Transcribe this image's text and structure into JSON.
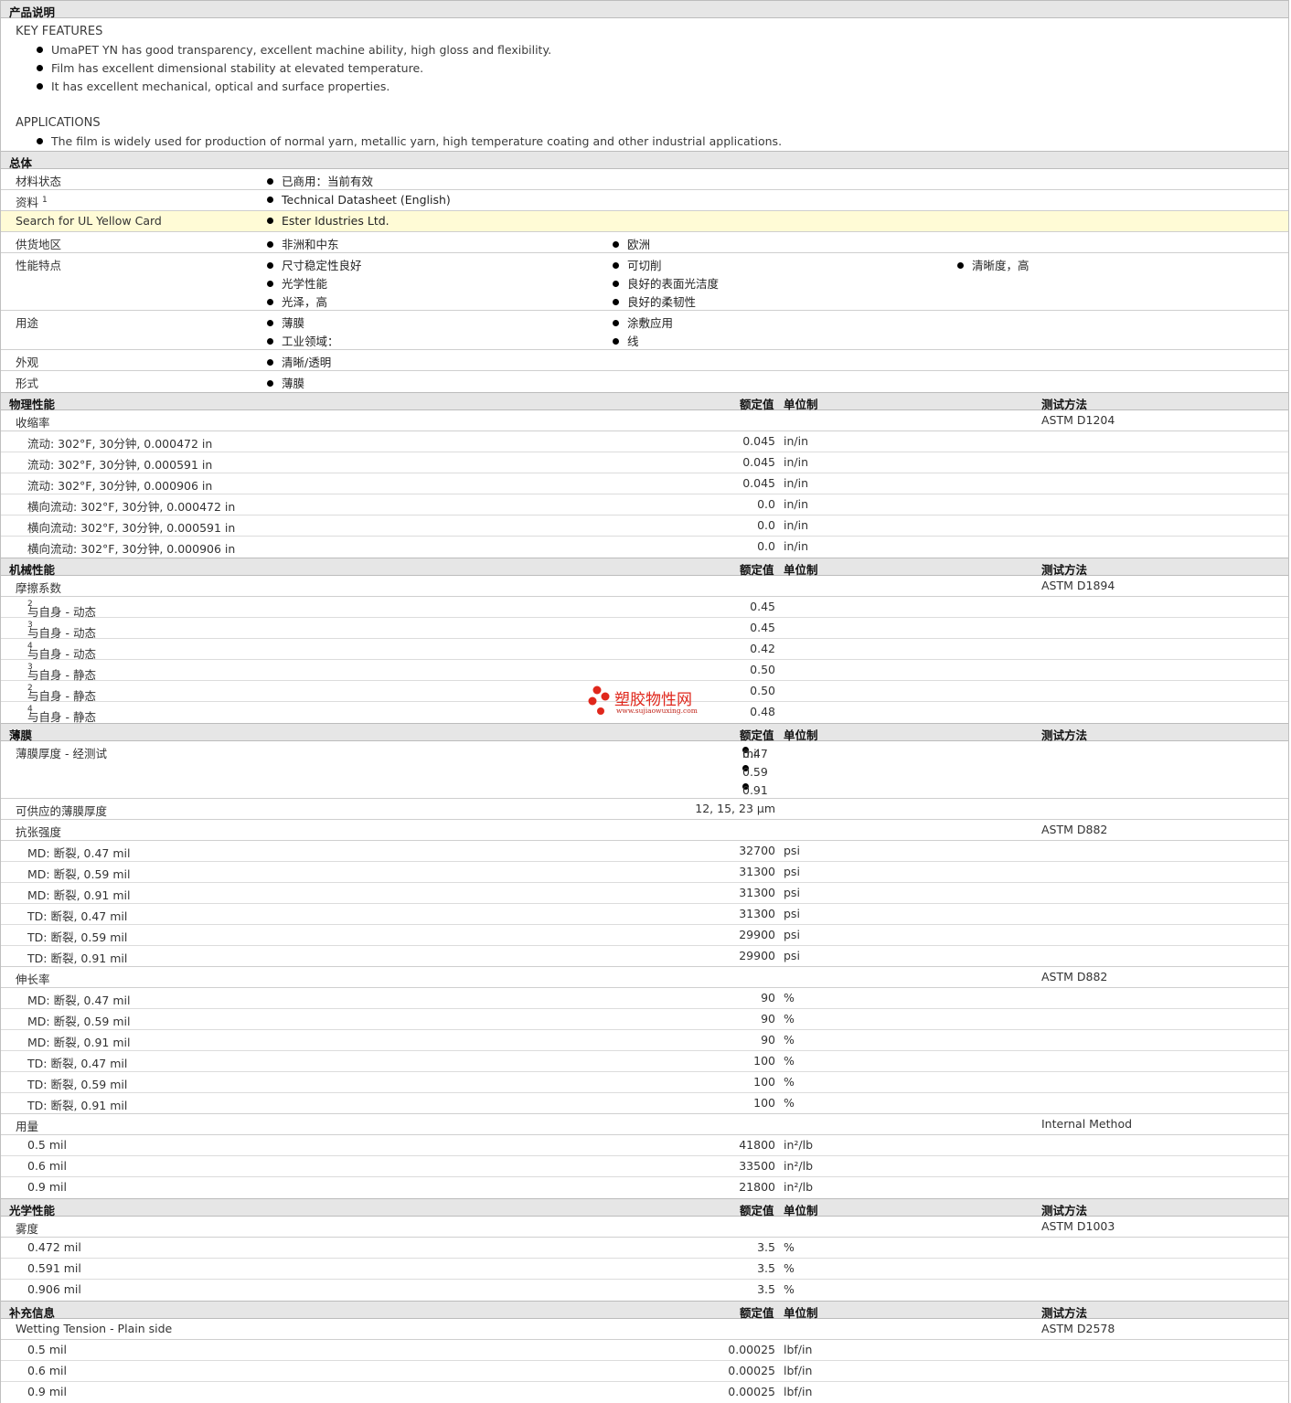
{
  "description": {
    "section_title": "产品说明",
    "key_features_heading": "KEY FEATURES",
    "key_features": [
      "UmaPET YN has good transparency, excellent machine ability, high gloss and flexibility.",
      "Film has excellent dimensional stability at elevated temperature.",
      "It has excellent mechanical, optical and surface properties."
    ],
    "applications_heading": "APPLICATIONS",
    "applications": [
      "The film is widely used for production of normal yarn, metallic yarn, high temperature coating and other industrial applications."
    ]
  },
  "general": {
    "section_title": "总体",
    "rows": [
      {
        "label": "材料状态",
        "items": [
          "已商用：当前有效"
        ]
      },
      {
        "label": "资料",
        "sup": "1",
        "items": [
          "Technical Datasheet (English)"
        ]
      },
      {
        "label": "Search for UL Yellow Card",
        "items": [
          "Ester Idustries Ltd."
        ]
      },
      {
        "label": "供货地区",
        "items": [
          "非洲和中东",
          "欧洲"
        ]
      },
      {
        "label": "性能特点",
        "items": [
          "尺寸稳定性良好",
          "可切削",
          "清晰度，高",
          "光学性能",
          "良好的表面光洁度",
          "光泽，高",
          "良好的柔韧性"
        ]
      },
      {
        "label": "用途",
        "items": [
          "薄膜",
          "涂敷应用",
          "工业领域：",
          "线"
        ]
      },
      {
        "label": "外观",
        "items": [
          "清晰/透明"
        ]
      },
      {
        "label": "形式",
        "items": [
          "薄膜"
        ]
      }
    ]
  },
  "headers": {
    "nominal": "额定值",
    "unit": "单位制",
    "method": "测试方法"
  },
  "physical": {
    "section_title": "物理性能",
    "group": "收缩率",
    "method": "ASTM D1204",
    "rows": [
      {
        "label": "流动: 302°F, 30分钟, 0.000472 in",
        "value": "0.045",
        "unit": "in/in"
      },
      {
        "label": "流动: 302°F, 30分钟, 0.000591 in",
        "value": "0.045",
        "unit": "in/in"
      },
      {
        "label": "流动: 302°F, 30分钟, 0.000906 in",
        "value": "0.045",
        "unit": "in/in"
      },
      {
        "label": "横向流动: 302°F, 30分钟, 0.000472 in",
        "value": "0.0",
        "unit": "in/in"
      },
      {
        "label": "横向流动: 302°F, 30分钟, 0.000591 in",
        "value": "0.0",
        "unit": "in/in"
      },
      {
        "label": "横向流动: 302°F, 30分钟, 0.000906 in",
        "value": "0.0",
        "unit": "in/in"
      }
    ]
  },
  "mechanical": {
    "section_title": "机械性能",
    "group": "摩擦系数",
    "method": "ASTM D1894",
    "rows": [
      {
        "label": "与自身  - 动态",
        "sup": "2",
        "value": "0.45"
      },
      {
        "label": "与自身  - 动态",
        "sup": "3",
        "value": "0.45"
      },
      {
        "label": "与自身  - 动态",
        "sup": "4",
        "value": "0.42"
      },
      {
        "label": "与自身  - 静态",
        "sup": "3",
        "value": "0.50"
      },
      {
        "label": "与自身  - 静态",
        "sup": "2",
        "value": "0.50"
      },
      {
        "label": "与自身  - 静态",
        "sup": "4",
        "value": "0.48"
      }
    ]
  },
  "film": {
    "section_title": "薄膜",
    "thickness": {
      "label": "薄膜厚度  - 经测试",
      "values": [
        "0.47",
        "0.59",
        "0.91"
      ],
      "unit": "mil"
    },
    "available": {
      "label": "可供应的薄膜厚度",
      "value": "12, 15, 23 µm"
    },
    "tensile": {
      "group": "抗张强度",
      "method": "ASTM D882",
      "rows": [
        {
          "label": "MD: 断裂, 0.47 mil",
          "value": "32700",
          "unit": "psi"
        },
        {
          "label": "MD: 断裂, 0.59 mil",
          "value": "31300",
          "unit": "psi"
        },
        {
          "label": "MD: 断裂, 0.91 mil",
          "value": "31300",
          "unit": "psi"
        },
        {
          "label": "TD: 断裂, 0.47 mil",
          "value": "31300",
          "unit": "psi"
        },
        {
          "label": "TD: 断裂, 0.59 mil",
          "value": "29900",
          "unit": "psi"
        },
        {
          "label": "TD: 断裂, 0.91 mil",
          "value": "29900",
          "unit": "psi"
        }
      ]
    },
    "elongation": {
      "group": "伸长率",
      "method": "ASTM D882",
      "rows": [
        {
          "label": "MD: 断裂, 0.47 mil",
          "value": "90",
          "unit": "%"
        },
        {
          "label": "MD: 断裂, 0.59 mil",
          "value": "90",
          "unit": "%"
        },
        {
          "label": "MD: 断裂, 0.91 mil",
          "value": "90",
          "unit": "%"
        },
        {
          "label": "TD: 断裂, 0.47 mil",
          "value": "100",
          "unit": "%"
        },
        {
          "label": "TD: 断裂, 0.59 mil",
          "value": "100",
          "unit": "%"
        },
        {
          "label": "TD: 断裂, 0.91 mil",
          "value": "100",
          "unit": "%"
        }
      ]
    },
    "yield": {
      "group": "用量",
      "method": "Internal Method",
      "rows": [
        {
          "label": "0.5 mil",
          "value": "41800",
          "unit": "in²/lb"
        },
        {
          "label": "0.6 mil",
          "value": "33500",
          "unit": "in²/lb"
        },
        {
          "label": "0.9 mil",
          "value": "21800",
          "unit": "in²/lb"
        }
      ]
    }
  },
  "optical": {
    "section_title": "光学性能",
    "group": "雾度",
    "method": "ASTM D1003",
    "rows": [
      {
        "label": "0.472 mil",
        "value": "3.5",
        "unit": "%"
      },
      {
        "label": "0.591 mil",
        "value": "3.5",
        "unit": "%"
      },
      {
        "label": "0.906 mil",
        "value": "3.5",
        "unit": "%"
      }
    ]
  },
  "supplemental": {
    "section_title": "补充信息",
    "group": "Wetting Tension - Plain side",
    "method": "ASTM D2578",
    "rows": [
      {
        "label": "0.5 mil",
        "value": "0.00025",
        "unit": "lbf/in"
      },
      {
        "label": "0.6 mil",
        "value": "0.00025",
        "unit": "lbf/in"
      },
      {
        "label": "0.9 mil",
        "value": "0.00025",
        "unit": "lbf/in"
      }
    ]
  },
  "watermark": {
    "title": "塑胶物性网",
    "url": "www.sujiaowuxing.com"
  },
  "colors": {
    "section_bg": "#e6e6e6",
    "highlight_bg": "#fffbd6",
    "link": "#6b1a3c",
    "watermark": "#e0271c"
  }
}
